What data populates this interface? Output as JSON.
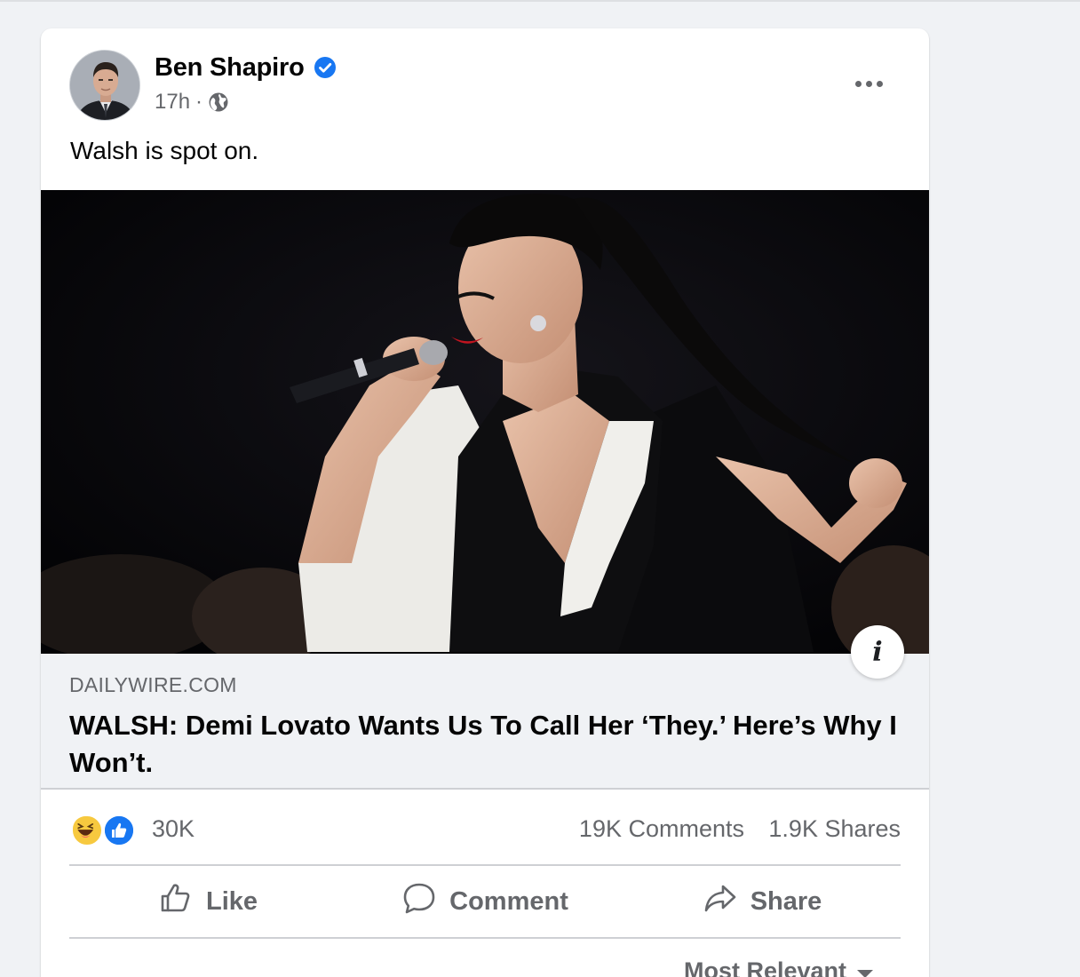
{
  "post": {
    "author": "Ben Shapiro",
    "timestamp": "17h",
    "separator": "·",
    "text": "Walsh is spot on."
  },
  "link": {
    "domain": "DAILYWIRE.COM",
    "title": "WALSH: Demi Lovato Wants Us To Call Her ‘They.’ Here’s Why I Won’t.",
    "info_glyph": "i"
  },
  "stats": {
    "reactions_count": "30K",
    "comments": "19K Comments",
    "shares": "1.9K Shares"
  },
  "actions": {
    "like": "Like",
    "comment": "Comment",
    "share": "Share"
  },
  "comments": {
    "sort_label": "Most Relevant"
  },
  "icons": {
    "verified": "verified-badge-icon",
    "audience": "globe-icon",
    "more": "more-options-icon",
    "info": "info-icon",
    "reactions": [
      "haha-reaction-icon",
      "like-reaction-icon"
    ],
    "like": "thumbs-up-icon",
    "comment": "speech-bubble-icon",
    "share": "share-arrow-icon",
    "sort": "caret-down-icon"
  },
  "colors": {
    "brand_blue": "#1877f2",
    "secondary_text": "#65676b",
    "page_background": "#f0f2f5",
    "haha_yellow": "#f7c93f"
  }
}
